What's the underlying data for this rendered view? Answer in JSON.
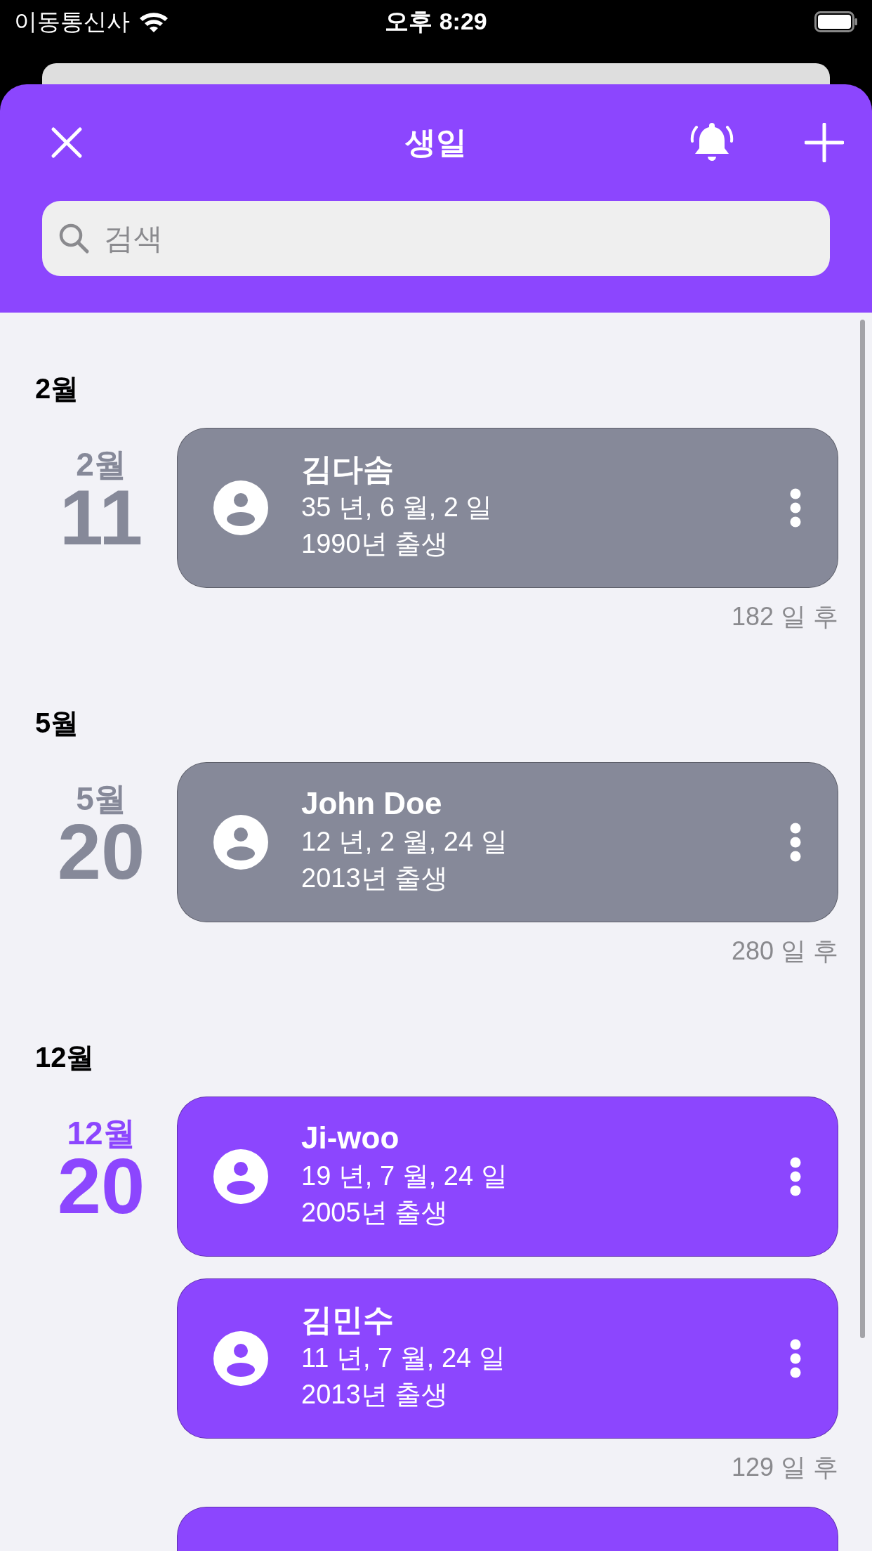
{
  "status_bar": {
    "carrier": "이동통신사",
    "time": "오후 8:29"
  },
  "header": {
    "title": "생일",
    "search": {
      "placeholder": "검색"
    }
  },
  "sections": [
    {
      "title": "2월",
      "dates": [
        {
          "month": "2월",
          "day": "11",
          "color": "#868999",
          "people": [
            {
              "name": "김다솜",
              "age": "35 년, 6 월, 2 일",
              "born": "1990년 출생"
            }
          ],
          "countdown": "182 일 후"
        }
      ]
    },
    {
      "title": "5월",
      "dates": [
        {
          "month": "5월",
          "day": "20",
          "color": "#868999",
          "people": [
            {
              "name": "John Doe",
              "age": "12 년, 2 월, 24 일",
              "born": "2013년 출생"
            }
          ],
          "countdown": "280 일 후"
        }
      ]
    },
    {
      "title": "12월",
      "dates": [
        {
          "month": "12월",
          "day": "20",
          "color": "#8c46fe",
          "people": [
            {
              "name": "Ji-woo",
              "age": "19 년, 7 월, 24 일",
              "born": "2005년 출생"
            },
            {
              "name": "김민수",
              "age": "11 년, 7 월, 24 일",
              "born": "2013년 출생"
            }
          ],
          "countdown": "129 일 후"
        },
        {
          "color": "#8c46fe"
        }
      ]
    }
  ]
}
